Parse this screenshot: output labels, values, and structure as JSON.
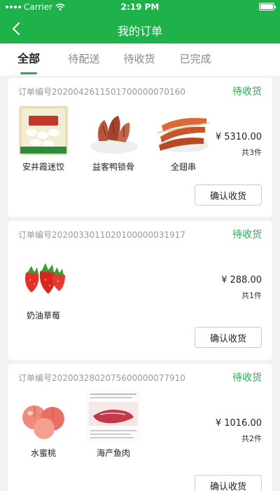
{
  "status_bar": {
    "carrier": "Carrier",
    "time": "2:19 PM"
  },
  "nav": {
    "title": "我的订单",
    "back_icon": "back-chevron-icon"
  },
  "tabs": [
    {
      "label": "全部",
      "active": true
    },
    {
      "label": "待配送",
      "active": false
    },
    {
      "label": "待收货",
      "active": false
    },
    {
      "label": "已完成",
      "active": false
    }
  ],
  "orders": [
    {
      "order_no": "订单编号2020042611501700000070160",
      "status": "待收货",
      "amount": "¥ 5310.00",
      "count": "共3件",
      "confirm_label": "确认收货",
      "products": [
        {
          "name": "安井霞迷饺"
        },
        {
          "name": "益客鸭锁骨"
        },
        {
          "name": "全翅串"
        }
      ]
    },
    {
      "order_no": "订单编号2020033011020100000031917",
      "status": "待收货",
      "amount": "¥ 288.00",
      "count": "共1件",
      "confirm_label": "确认收货",
      "products": [
        {
          "name": "奶油草莓"
        }
      ]
    },
    {
      "order_no": "订单编号2020032802075600000077910",
      "status": "待收货",
      "amount": "¥ 1016.00",
      "count": "共2件",
      "confirm_label": "确认收货",
      "products": [
        {
          "name": "水蜜桃"
        },
        {
          "name": "海产鱼肉"
        }
      ]
    }
  ],
  "colors": {
    "brand": "#1fb24a",
    "background": "#f2f2f2"
  }
}
